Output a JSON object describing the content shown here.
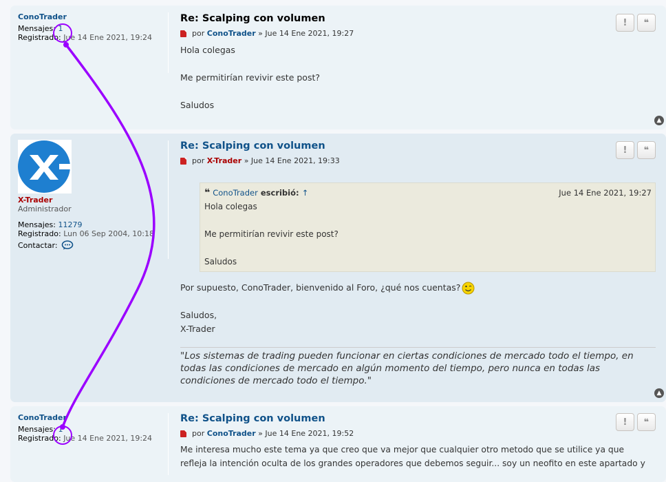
{
  "posts": [
    {
      "author": "ConoTrader",
      "mensajes_label": "Mensajes:",
      "mensajes_val": "1",
      "registrado_label": "Registrado:",
      "registrado_val": "Jue 14 Ene 2021, 19:24",
      "title": "Re: Scalping con volumen",
      "por": "por",
      "sep": "» Jue 14 Ene 2021, 19:27",
      "lines": [
        "Hola colegas",
        "Me permitirían revivir este post?",
        "Saludos"
      ]
    },
    {
      "author": "X-Trader",
      "rank": "Administrador",
      "mensajes_label": "Mensajes:",
      "mensajes_val": "11279",
      "registrado_label": "Registrado:",
      "registrado_val": "Lun 06 Sep 2004, 10:18",
      "contactar_label": "Contactar:",
      "title": "Re: Scalping con volumen",
      "por": "por",
      "sep": "» Jue 14 Ene 2021, 19:33",
      "quote": {
        "user": "ConoTrader",
        "wrote": "escribió:",
        "arrow": "↑",
        "date": "Jue 14 Ene 2021, 19:27",
        "lines": [
          "Hola colegas",
          "Me permitirían revivir este post?",
          "Saludos"
        ]
      },
      "reply": "Por supuesto, ConoTrader, bienvenido al Foro, ¿qué nos cuentas?",
      "closing1": "Saludos,",
      "closing2": "X-Trader",
      "signature": "\"Los sistemas de trading pueden funcionar en ciertas condiciones de mercado todo el tiempo, en todas las condiciones de mercado en algún momento del tiempo, pero nunca en todas las condiciones de mercado todo el tiempo.\""
    },
    {
      "author": "ConoTrader",
      "mensajes_label": "Mensajes:",
      "mensajes_val": "1",
      "registrado_label": "Registrado:",
      "registrado_val": "Jue 14 Ene 2021, 19:24",
      "title": "Re: Scalping con volumen",
      "por": "por",
      "sep": "» Jue 14 Ene 2021, 19:52",
      "line1": "Me interesa mucho este tema ya que creo que va mejor que cualquier otro metodo que se utilice ya que",
      "line2": "refleja la intención oculta de los grandes operadores que debemos seguir... soy un neofito en este apartado y"
    }
  ],
  "buttons": {
    "report": "!",
    "quote": "❝"
  },
  "icons": [
    "post-icon",
    "report-icon",
    "quote-icon",
    "back-to-top-icon",
    "speech-bubble-icon",
    "smiley-icon",
    "avatar-logo"
  ],
  "colors": {
    "link": "#105289",
    "admin": "#aa0000",
    "annotation": "#9b00ff"
  }
}
